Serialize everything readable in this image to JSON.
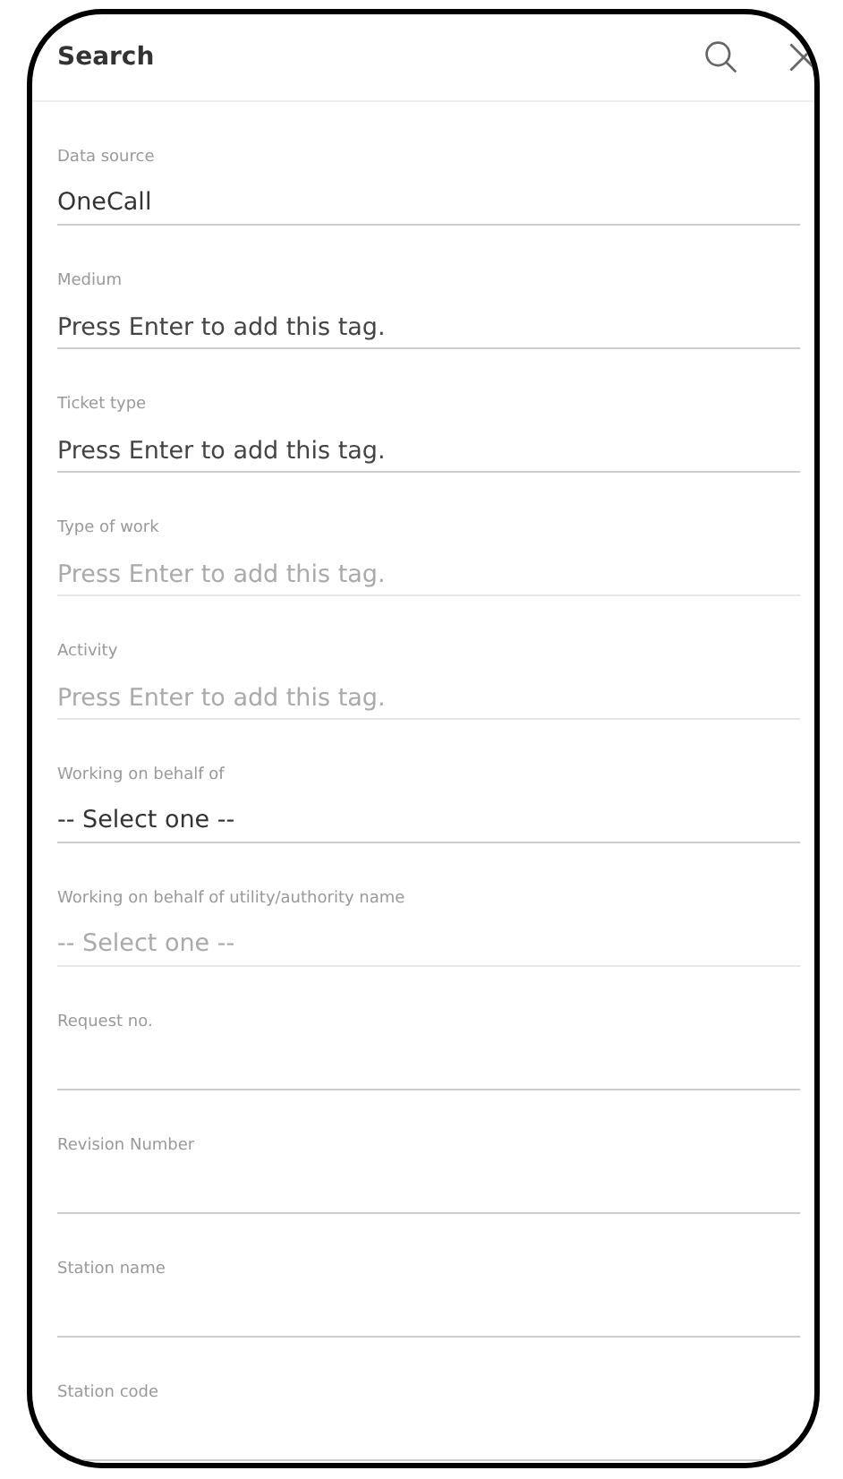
{
  "header": {
    "title": "Search"
  },
  "fields": [
    {
      "kind": "select",
      "label": "Data source",
      "value": "OneCall",
      "disabled": false
    },
    {
      "kind": "tags",
      "label": "Medium",
      "placeholder": "Press Enter to add this tag.",
      "disabled": false
    },
    {
      "kind": "tags",
      "label": "Ticket type",
      "placeholder": "Press Enter to add this tag.",
      "disabled": false
    },
    {
      "kind": "tags",
      "label": "Type of work",
      "placeholder": "Press Enter to add this tag.",
      "disabled": true
    },
    {
      "kind": "tags",
      "label": "Activity",
      "placeholder": "Press Enter to add this tag.",
      "disabled": true
    },
    {
      "kind": "select",
      "label": "Working on behalf of",
      "value": "-- Select one --",
      "disabled": false
    },
    {
      "kind": "select",
      "label": "Working on behalf of utility/authority name",
      "value": "-- Select one --",
      "disabled": true
    },
    {
      "kind": "text",
      "label": "Request no.",
      "disabled": false
    },
    {
      "kind": "text",
      "label": "Revision Number",
      "disabled": false
    },
    {
      "kind": "text",
      "label": "Station name",
      "disabled": false
    },
    {
      "kind": "text",
      "label": "Station code",
      "disabled": false
    }
  ]
}
